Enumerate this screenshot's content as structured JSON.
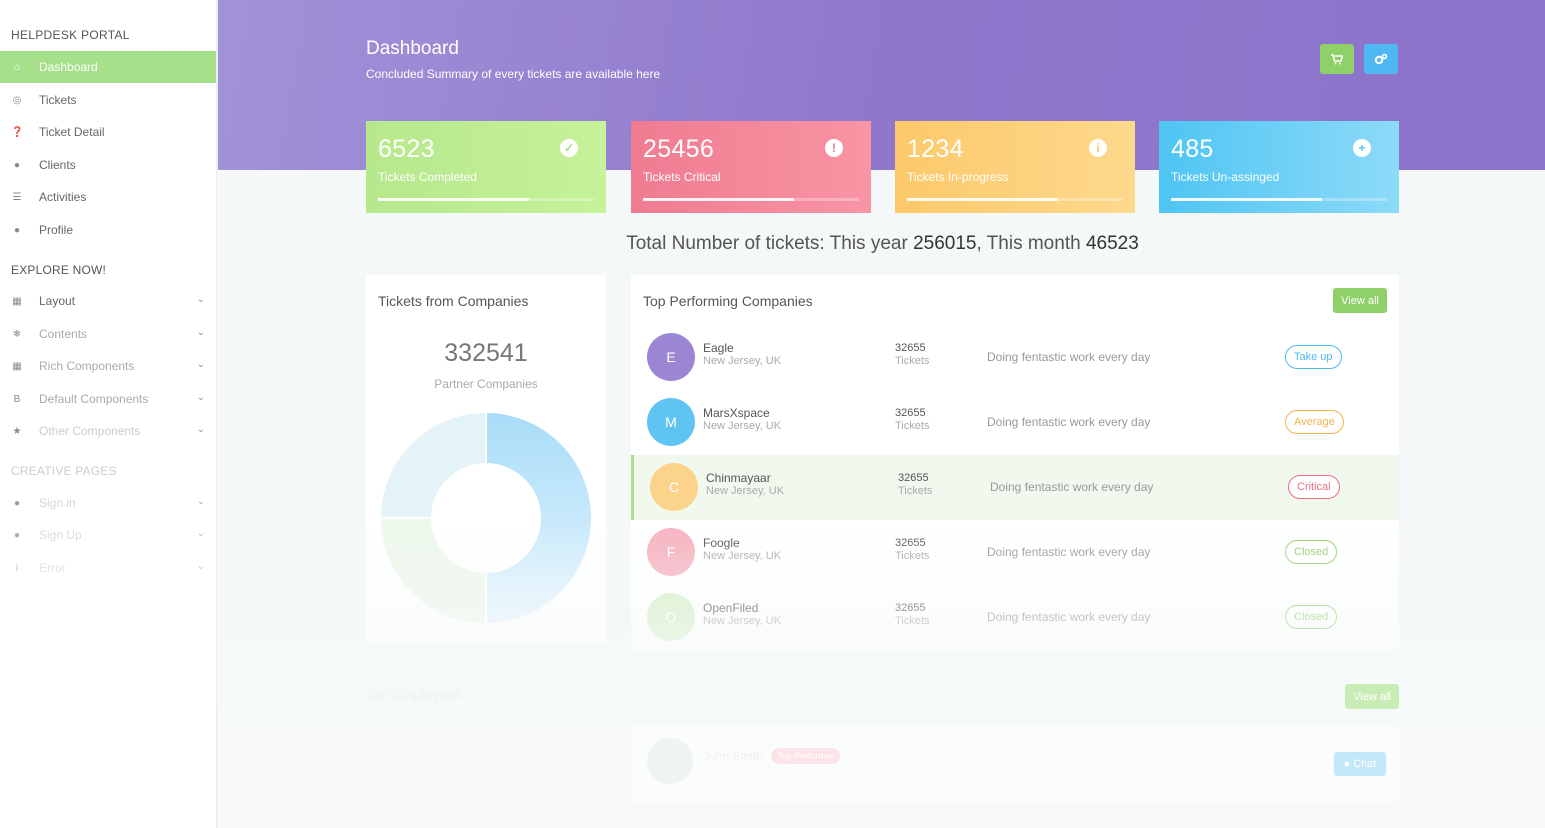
{
  "sidebar": {
    "brand": "HELPDESK PORTAL",
    "items": [
      {
        "label": "Dashboard",
        "icon": "home-icon"
      },
      {
        "label": "Tickets",
        "icon": "lifebuoy-icon"
      },
      {
        "label": "Ticket Detail",
        "icon": "question-circle-icon"
      },
      {
        "label": "Clients",
        "icon": "comments-icon"
      },
      {
        "label": "Activities",
        "icon": "list-icon"
      },
      {
        "label": "Profile",
        "icon": "user-icon"
      }
    ],
    "explore_title": "EXPLORE NOW!",
    "explore_items": [
      {
        "label": "Layout",
        "icon": "layout-icon"
      },
      {
        "label": "Contents",
        "icon": "snowflake-icon"
      },
      {
        "label": "Rich Components",
        "icon": "grid-icon"
      },
      {
        "label": "Default Components",
        "icon": "bootstrap-icon"
      },
      {
        "label": "Other Components",
        "icon": "star-icon"
      }
    ],
    "creative_title": "CREATIVE PAGES",
    "creative_items": [
      {
        "label": "Sign in",
        "icon": "user-circle-icon"
      },
      {
        "label": "Sign Up",
        "icon": "user-plus-icon"
      },
      {
        "label": "Error",
        "icon": "info-icon"
      }
    ]
  },
  "header": {
    "title": "Dashboard",
    "subtitle": "Concluded Summary of every tickets are available here",
    "buttons": [
      {
        "icon": "cart-icon",
        "color": "#8fd068"
      },
      {
        "icon": "cogs-icon",
        "color": "#4fb8f2"
      }
    ]
  },
  "stats": [
    {
      "value": "6523",
      "label": "Tickets Completed",
      "icon": "check-circle-icon",
      "progress": 0.7
    },
    {
      "value": "25456",
      "label": "Tickets Critical",
      "icon": "exclamation-circle-icon",
      "progress": 0.7
    },
    {
      "value": "1234",
      "label": "Tickets In-progress",
      "icon": "info-circle-icon",
      "progress": 0.7
    },
    {
      "value": "485",
      "label": "Tickets Un-assinged",
      "icon": "plus-circle-icon",
      "progress": 0.7
    }
  ],
  "totals": {
    "prefix": "Total Number of tickets: This year ",
    "year": "256015",
    "middle": ", This month ",
    "month": "46523"
  },
  "companies_panel": {
    "title": "Tickets from Companies",
    "value": "332541",
    "label": "Partner Companies",
    "donut_shares": [
      0.5,
      0.25,
      0.25
    ]
  },
  "top_companies": {
    "title": "Top Performing Companies",
    "view_all": "View all",
    "rows": [
      {
        "initial": "E",
        "name": "Eagle",
        "location": "New Jersey, UK",
        "count": "32655",
        "unit": "Tickets",
        "desc": "Doing fentastic work every day",
        "status": "Take up",
        "status_color": "#4fb8f2",
        "avatar_color": "#9b86d4"
      },
      {
        "initial": "M",
        "name": "MarsXspace",
        "location": "New Jersey, UK",
        "count": "32655",
        "unit": "Tickets",
        "desc": "Doing fentastic work every day",
        "status": "Average",
        "status_color": "#f5b44e",
        "avatar_color": "#5fc4f2"
      },
      {
        "initial": "C",
        "name": "Chinmayaar",
        "location": "New Jersey, UK",
        "count": "32655",
        "unit": "Tickets",
        "desc": "Doing fentastic work every day",
        "status": "Critical",
        "status_color": "#ec6f86",
        "avatar_color": "#fcd38a"
      },
      {
        "initial": "F",
        "name": "Foogle",
        "location": "New Jersey, UK",
        "count": "32655",
        "unit": "Tickets",
        "desc": "Doing fentastic work every day",
        "status": "Closed",
        "status_color": "#8fd068",
        "avatar_color": "#f6b3c0"
      },
      {
        "initial": "O",
        "name": "OpenFiled",
        "location": "New Jersey, UK",
        "count": "32655",
        "unit": "Tickets",
        "desc": "Doing fentastic work every day",
        "status": "Closed",
        "status_color": "#8fd068",
        "avatar_color": "#d7f0c8"
      }
    ]
  },
  "employees": {
    "title": "Top Employees",
    "view_all": "View all",
    "name": "John Smith",
    "badge": "Top Performer",
    "chat": "Chat"
  }
}
